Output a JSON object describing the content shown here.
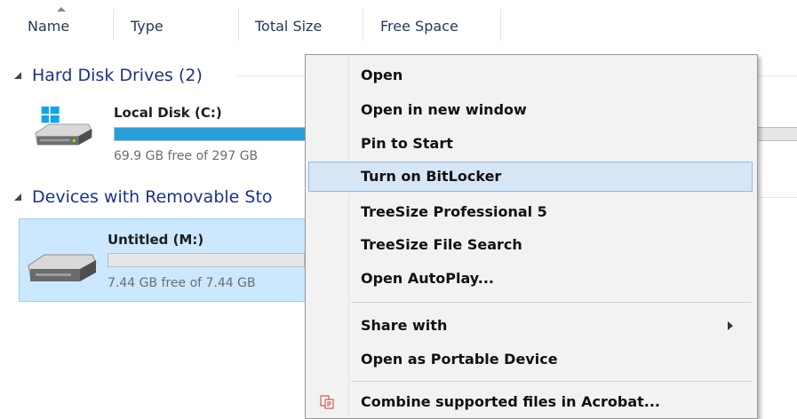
{
  "columns": [
    "Name",
    "Type",
    "Total Size",
    "Free Space"
  ],
  "groups": {
    "hdd": "Hard Disk Drives (2)",
    "removable": "Devices with Removable Sto"
  },
  "drives": [
    {
      "name": "Local Disk (C:)",
      "free": "69.9 GB free of 297 GB",
      "used_fraction": 0.765
    },
    {
      "name": "Untitled (M:)",
      "free": "7.44 GB free of 7.44 GB",
      "used_fraction": 0.0
    }
  ],
  "menu": {
    "items": [
      "Open",
      "Open in new window",
      "Pin to Start",
      "Turn on BitLocker",
      "TreeSize Professional 5",
      "TreeSize File Search",
      "Open AutoPlay...",
      "Share with",
      "Open as Portable Device",
      "Combine supported files in Acrobat..."
    ],
    "highlighted_index": 3
  },
  "colors": {
    "accent": "#26a0da",
    "group_text": "#1e3287",
    "selection_bg": "#cce8ff",
    "menu_highlight": "#d7e6f5"
  }
}
